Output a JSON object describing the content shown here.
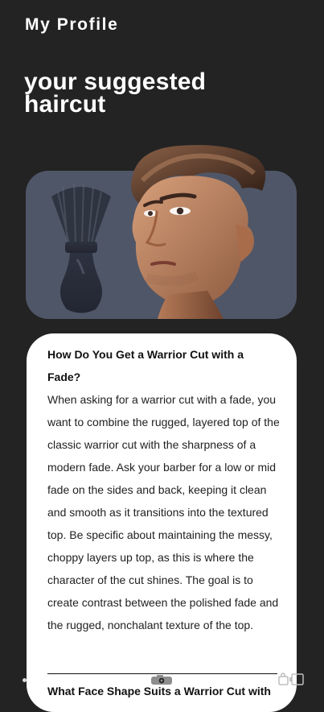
{
  "header": {
    "title": "My Profile"
  },
  "hero": {
    "title": "your suggested haircut"
  },
  "hero_card": {
    "brush_icon": "shaving-brush-icon",
    "portrait_icon": "haircut-portrait",
    "accent": "#4f5667"
  },
  "info_card": {
    "section1": {
      "title": "How Do You Get a Warrior Cut with a Fade?",
      "body": "When asking for a warrior cut with a fade, you want to combine the rugged, layered top of the classic warrior cut with the sharpness of a modern fade. Ask your barber for a low or mid fade on the sides and back, keeping it clean and smooth as it transitions into the textured top. Be specific about maintaining the messy, choppy layers up top, as this is where the character of the cut shines. The goal is to create contrast between the polished fade and the rugged, nonchalant texture of the top."
    },
    "section2": {
      "title": "What Face Shape Suits a Warrior Cut with"
    }
  },
  "bottom_icons": {
    "left": "nav-dot",
    "center": "camera-icon",
    "right": "device-icons"
  },
  "colors": {
    "background": "#232323",
    "card": "#ffffff",
    "hero_card": "#4f5667",
    "text_primary": "#111111",
    "text_body": "#1f1f1f"
  }
}
